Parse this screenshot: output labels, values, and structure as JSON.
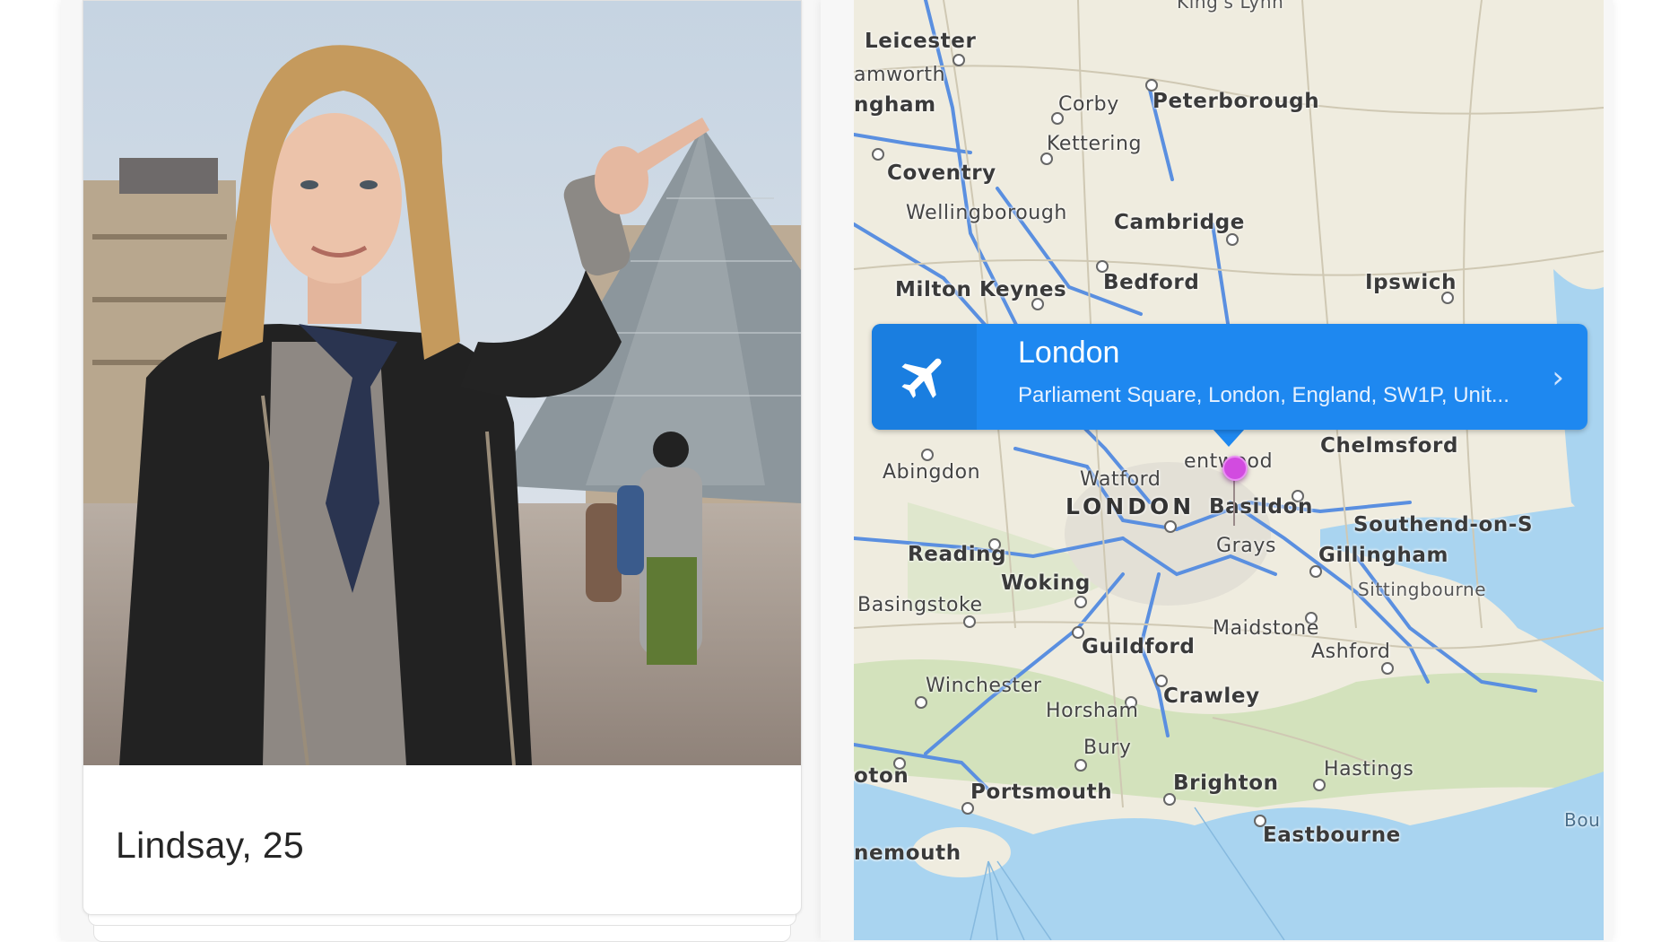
{
  "profile_card": {
    "name_age": "Lindsay, 25",
    "photo_icon": "person-photo"
  },
  "map": {
    "callout": {
      "title": "London",
      "subtitle": "Parliament Square, London, England, SW1P, Unit...",
      "icon": "airplane-icon",
      "chevron": "chevron-right-icon",
      "color": "#1e88f0"
    },
    "pin_color": "#d24be0",
    "places": {
      "leicester": "Leicester",
      "tamworth": "amworth",
      "ingham": "ngham",
      "corby": "Corby",
      "peterborough": "Peterborough",
      "kettering": "Kettering",
      "coventry": "Coventry",
      "wellingborough": "Wellingborough",
      "cambridge": "Cambridge",
      "bedford": "Bedford",
      "milton_keynes": "Milton Keynes",
      "ipswich": "Ipswich",
      "kings_lynn": "King's Lynn",
      "abingdon": "Abingdon",
      "watford": "Watford",
      "brentwood": "entwood",
      "chelmsford": "Chelmsford",
      "london": "LONDON",
      "basildon": "Basildon",
      "southend": "Southend-on-S",
      "reading": "Reading",
      "grays": "Grays",
      "gillingham": "Gillingham",
      "woking": "Woking",
      "sittingbourne": "Sittingbourne",
      "basingstoke": "Basingstoke",
      "maidstone": "Maidstone",
      "guildford": "Guildford",
      "ashford": "Ashford",
      "winchester": "Winchester",
      "crawley": "Crawley",
      "horsham": "Horsham",
      "bury": "Bury",
      "hastings": "Hastings",
      "southampton": "oton",
      "portsmouth": "Portsmouth",
      "brighton": "Brighton",
      "eastbourne": "Eastbourne",
      "bournemouth": "nemouth",
      "boulogne": "Bou"
    }
  }
}
